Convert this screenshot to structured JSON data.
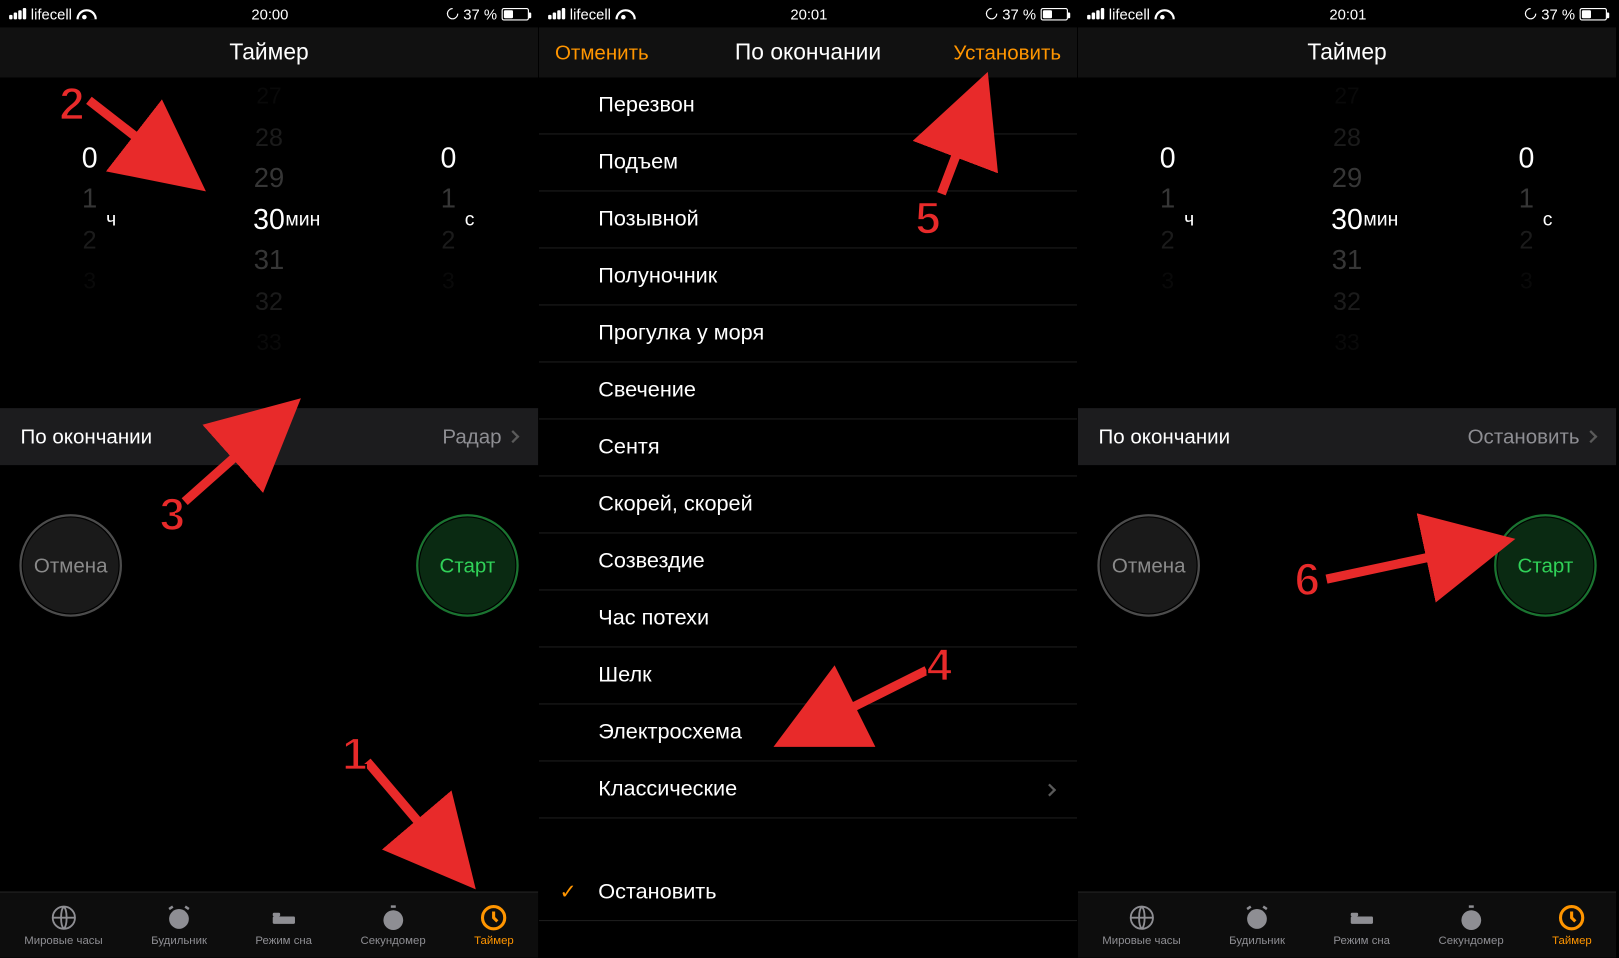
{
  "status": {
    "carrier": "lifecell",
    "battery_pct": "37 %"
  },
  "times": {
    "p1": "20:00",
    "p2": "20:01",
    "p3": "20:01"
  },
  "titles": {
    "timer": "Таймер",
    "when_ends": "По окончании"
  },
  "header2": {
    "cancel": "Отменить",
    "set": "Установить"
  },
  "picker": {
    "h": {
      "above": [],
      "sel": "0",
      "below": [
        "1",
        "2",
        "3"
      ],
      "unit": "ч"
    },
    "m": {
      "above": [
        "27",
        "28",
        "29"
      ],
      "sel": "30",
      "below": [
        "31",
        "32",
        "33"
      ],
      "unit": "мин"
    },
    "s": {
      "above": [],
      "sel": "0",
      "below": [
        "1",
        "2",
        "3"
      ],
      "unit": "с"
    }
  },
  "row1": {
    "label": "По окончании",
    "value": "Радар"
  },
  "row3": {
    "label": "По окончании",
    "value": "Остановить"
  },
  "buttons": {
    "cancel": "Отмена",
    "start": "Старт"
  },
  "soundlist": {
    "items": [
      "Перезвон",
      "Подъем",
      "Позывной",
      "Полуночник",
      "Прогулка у моря",
      "Свечение",
      "Сентя",
      "Скорей, скорей",
      "Созвездие",
      "Час потехи",
      "Шелк",
      "Электросхема"
    ],
    "classic": "Классические",
    "stop": "Остановить"
  },
  "tabs": {
    "world": "Мировые часы",
    "alarm": "Будильник",
    "sleep": "Режим сна",
    "stopwatch": "Секундомер",
    "timer": "Таймер"
  },
  "annot": {
    "n1": "1",
    "n2": "2",
    "n3": "3",
    "n4": "4",
    "n5": "5",
    "n6": "6"
  }
}
